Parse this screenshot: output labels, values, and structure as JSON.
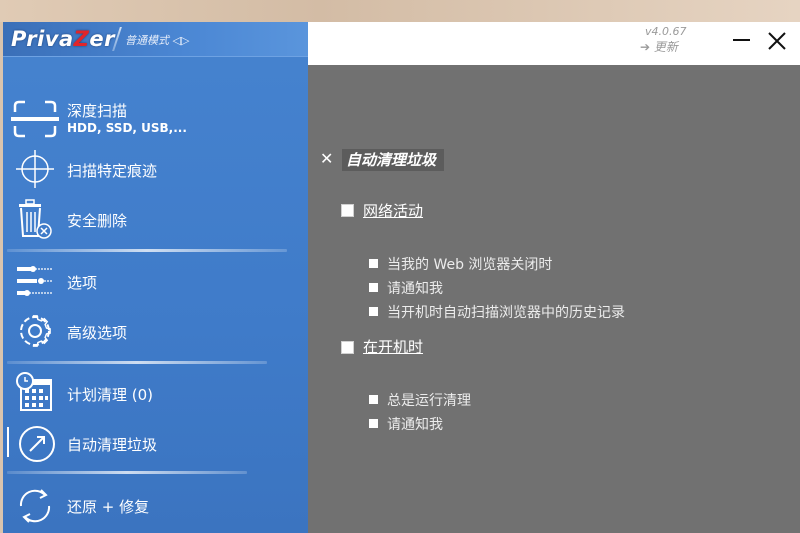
{
  "app": {
    "logo_left": "Priva",
    "logo_z": "Z",
    "logo_right": "er",
    "mode_label": "普通模式 ◁▷",
    "version": "v4.0.67",
    "update_label": "➔ 更新"
  },
  "sidebar": {
    "items": [
      {
        "label": "深度扫描",
        "sublabel": "HDD, SSD, USB,..."
      },
      {
        "label": "扫描特定痕迹"
      },
      {
        "label": "安全删除"
      },
      {
        "label": "选项"
      },
      {
        "label": "高级选项"
      },
      {
        "label": "计划清理 (0)"
      },
      {
        "label": "自动清理垃圾"
      },
      {
        "label": "还原 + 修复"
      }
    ],
    "active_item": "自动清理垃圾"
  },
  "content": {
    "section_close": "✕",
    "section_title": "自动清理垃圾",
    "groups": [
      {
        "label": "网络活动",
        "options": [
          "当我的 Web 浏览器关闭时",
          "请通知我",
          "当开机时自动扫描浏览器中的历史记录"
        ]
      },
      {
        "label": "在开机时",
        "options": [
          "总是运行清理",
          "请通知我"
        ]
      }
    ]
  },
  "colors": {
    "sidebar_blue": "#4683cf",
    "content_gray": "#717171",
    "logo_accent": "#e1252a"
  }
}
